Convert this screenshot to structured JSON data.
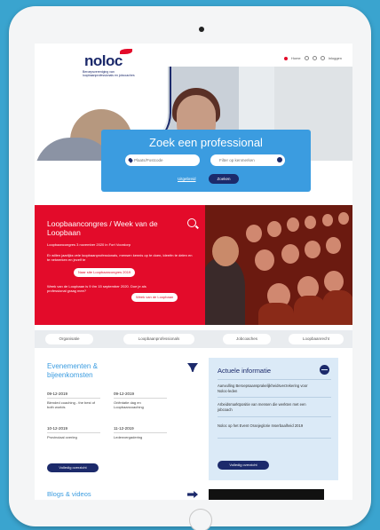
{
  "header": {
    "logo_text": "noloc",
    "logo_subtitle": "Beroepsvereniging van loopbaanprofessionals en jobcoaches",
    "nav_home": "Home",
    "nav_login": "Inloggen"
  },
  "search": {
    "title": "Zoek een professional",
    "location_placeholder": "Plaats/Postcode",
    "filter_placeholder": "Filter op kenmerken",
    "link_label": "Uitgebreid",
    "button_label": "Zoeken"
  },
  "promo": {
    "title": "Loopbaancongres / Week van de Loopbaan",
    "line1": "Loopbaancongres 3 november 2020 in Fort Voordorp",
    "line2": "Er willen jaarlijks vele loopbaanprofessionals, mensen kennis op te doen, ideeën te delen en te netwerken en jezelf te",
    "button1": "Naar site Loopbaancongres 2019",
    "line3": "Week van de Loopbaan is 9 t/m 15 september 2020. Doe je als professional graag mee?",
    "button2": "Week van de Loopbaan"
  },
  "tabs": [
    "Organisatie",
    "Loopbaanprofessionals",
    "Jobcoaches",
    "Loopbaanrecht"
  ],
  "events": {
    "title": "Evenementen & bijeenkomsten",
    "items": [
      {
        "date": "09-12-2019",
        "text": "Blended coaching - the best of both worlds"
      },
      {
        "date": "09-12-2019",
        "text": "Oriëntatie dag en Loopbaancoaching"
      },
      {
        "date": "10-12-2019",
        "text": "Provinciaal overleg"
      },
      {
        "date": "11-12-2019",
        "text": "Ledenvergadering"
      }
    ],
    "button": "Volledig overzicht"
  },
  "news": {
    "title": "Actuele informatie",
    "items": [
      "Aanvulling Beroepsaansprakelijkheidsverzekering voor Noloc-leden",
      "Arbeidsmarktpositie van mensen die werkten met een jobcoach",
      "Noloc op het Event Oranjeglorie Inserbaalheid 2019"
    ],
    "button": "Volledig overzicht"
  },
  "blogs": {
    "title": "Blogs & videos"
  },
  "colors": {
    "brand_navy": "#1c2a6b",
    "brand_blue": "#3b9ce0",
    "brand_red": "#e30b2a",
    "frame_bg": "#3aa4cf"
  }
}
